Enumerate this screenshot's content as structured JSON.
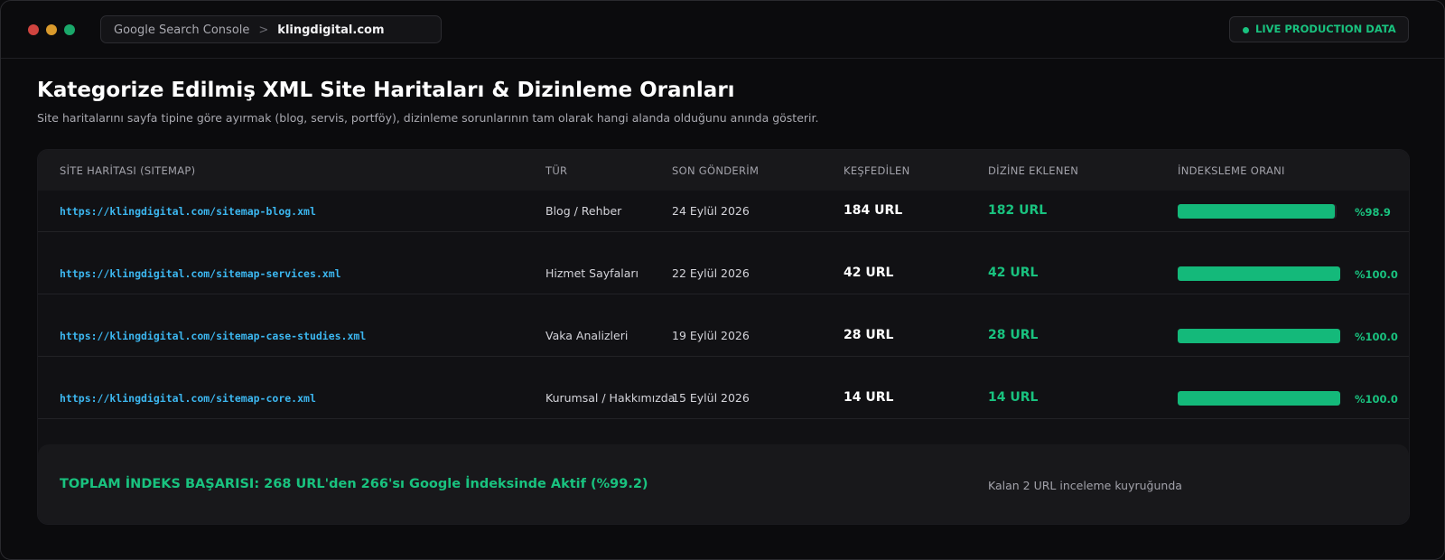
{
  "titlebar": {
    "breadcrumb": [
      "Google Search Console",
      "klingdigital.com"
    ],
    "separator": ">",
    "live_badge": "LIVE PRODUCTION DATA"
  },
  "page": {
    "title": "Kategorize Edilmiş XML Site Haritaları & Dizinleme Oranları",
    "subtitle": "Site haritalarını sayfa tipine göre ayırmak (blog, servis, portföy), dizinleme sorunlarının tam olarak hangi alanda olduğunu anında gösterir."
  },
  "table": {
    "headers": {
      "sitemap": "SİTE HARİTASI (SITEMAP)",
      "type": "TÜR",
      "last_submitted": "SON GÖNDERİM",
      "discovered": "KEŞFEDİLEN",
      "indexed": "DİZİNE EKLENEN",
      "rate": "İNDEKSLEME ORANI"
    },
    "rows": [
      {
        "url": "https://klingdigital.com/sitemap-blog.xml",
        "type": "Blog / Rehber",
        "date": "24 Eylül 2026",
        "discovered": "184 URL",
        "indexed": "182 URL",
        "rate": 98.9,
        "rate_label": "%98.9"
      },
      {
        "url": "https://klingdigital.com/sitemap-services.xml",
        "type": "Hizmet Sayfaları",
        "date": "22 Eylül 2026",
        "discovered": "42 URL",
        "indexed": "42 URL",
        "rate": 100.0,
        "rate_label": "%100.0"
      },
      {
        "url": "https://klingdigital.com/sitemap-case-studies.xml",
        "type": "Vaka Analizleri",
        "date": "19 Eylül 2026",
        "discovered": "28 URL",
        "indexed": "28 URL",
        "rate": 100.0,
        "rate_label": "%100.0"
      },
      {
        "url": "https://klingdigital.com/sitemap-core.xml",
        "type": "Kurumsal / Hakkımızda",
        "date": "15 Eylül 2026",
        "discovered": "14 URL",
        "indexed": "14 URL",
        "rate": 100.0,
        "rate_label": "%100.0"
      }
    ]
  },
  "summary": {
    "total": "TOPLAM İNDEKS BAŞARISI: 268 URL'den 266'sı Google İndeksinde Aktif (%99.2)",
    "note": "Kalan 2 URL inceleme kuyruğunda"
  },
  "colors": {
    "accent_green": "#14b97a",
    "link_blue": "#3cb7f0",
    "background": "#0b0b0d"
  }
}
